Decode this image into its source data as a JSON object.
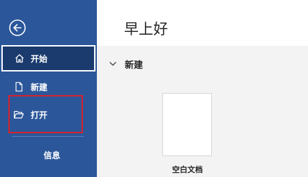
{
  "sidebar": {
    "back_icon": "circle-arrow-left-icon",
    "items": [
      {
        "label": "开始",
        "icon": "home-icon",
        "selected": true
      },
      {
        "label": "新建",
        "icon": "new-document-icon"
      },
      {
        "label": "打开",
        "icon": "folder-open-icon"
      },
      {
        "label": "信息"
      }
    ]
  },
  "main": {
    "greeting": "早上好",
    "new_section": {
      "title": "新建",
      "templates": [
        {
          "label": "空白文档"
        }
      ]
    }
  },
  "colors": {
    "sidebar_bg": "#2b579a",
    "selected_bg": "#1b3b6f",
    "highlight_border": "#d9202b"
  }
}
